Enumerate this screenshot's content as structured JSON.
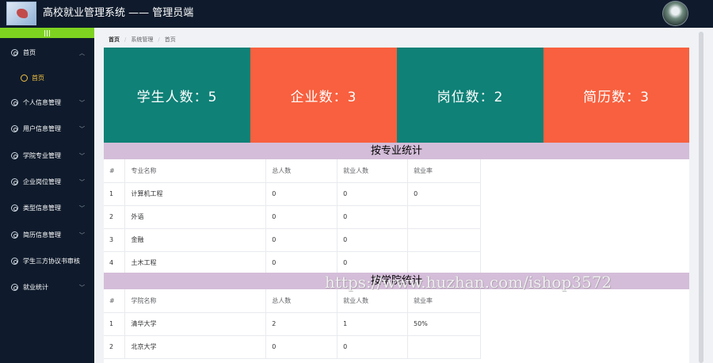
{
  "header": {
    "title": "高校就业管理系统 —— 管理员端"
  },
  "sidebar": {
    "toggle": "|||",
    "items": [
      {
        "label": "首页",
        "expanded": true,
        "children": [
          {
            "label": "首页"
          }
        ]
      },
      {
        "label": "个人信息管理"
      },
      {
        "label": "用户信息管理"
      },
      {
        "label": "学院专业管理"
      },
      {
        "label": "企业岗位管理"
      },
      {
        "label": "类型信息管理"
      },
      {
        "label": "简历信息管理"
      },
      {
        "label": "学生三方协议书审核"
      },
      {
        "label": "就业统计"
      }
    ]
  },
  "breadcrumb": [
    "首页",
    "系统管理",
    "首页"
  ],
  "stats": [
    {
      "label": "学生人数：5",
      "color": "#0f8177"
    },
    {
      "label": "企业数：3",
      "color": "#f8603f"
    },
    {
      "label": "岗位数：2",
      "color": "#0f8177"
    },
    {
      "label": "简历数：3",
      "color": "#f8603f"
    }
  ],
  "major_section": {
    "title": "按专业统计",
    "headers": [
      "#",
      "专业名称",
      "总人数",
      "就业人数",
      "就业率"
    ],
    "rows": [
      [
        "1",
        "计算机工程",
        "0",
        "0",
        "0"
      ],
      [
        "2",
        "外语",
        "0",
        "0",
        ""
      ],
      [
        "3",
        "金融",
        "0",
        "0",
        ""
      ],
      [
        "4",
        "土木工程",
        "0",
        "0",
        ""
      ]
    ]
  },
  "college_section": {
    "title": "按学院统计",
    "headers": [
      "#",
      "学院名称",
      "总人数",
      "就业人数",
      "就业率"
    ],
    "rows": [
      [
        "1",
        "清华大学",
        "2",
        "1",
        "50%"
      ],
      [
        "2",
        "北京大学",
        "0",
        "0",
        ""
      ]
    ]
  },
  "watermark": "https://www.huzhan.com/ishop3572"
}
